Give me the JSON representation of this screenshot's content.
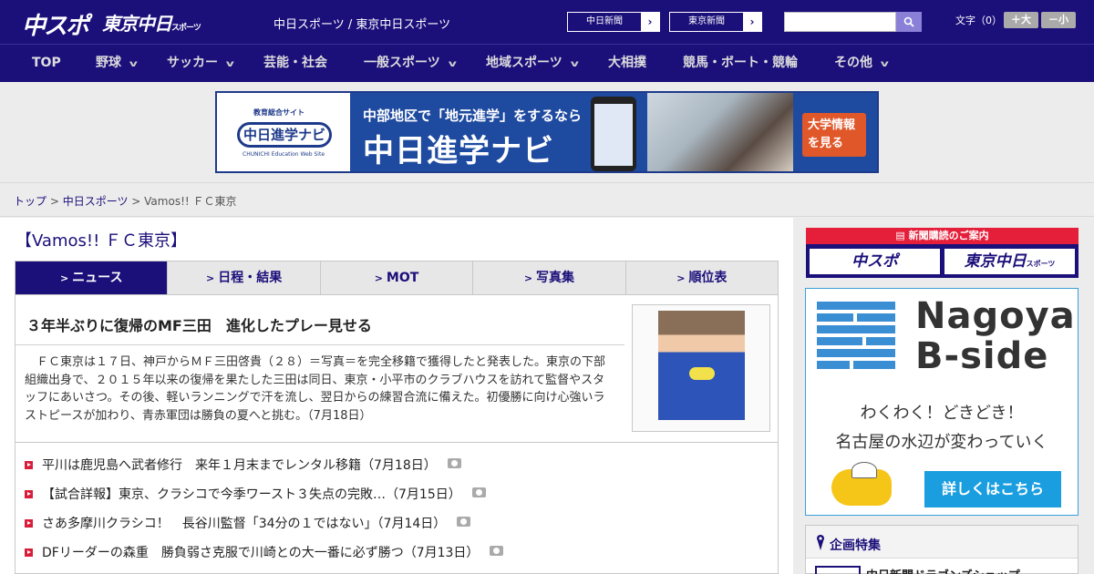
{
  "header": {
    "logo_main": "中スポ",
    "logo_tokyo": "東京中日",
    "logo_tokyo_small": "スポーツ",
    "site_name": "中日スポーツ / 東京中日スポーツ",
    "paper_buttons": [
      "中日新聞",
      "東京新聞"
    ],
    "search_placeholder": "",
    "text_size_label": "文字（0）",
    "size_up": "＋大",
    "size_down": "－小"
  },
  "nav": {
    "items": [
      {
        "label": "TOP",
        "dropdown": false
      },
      {
        "label": "野球",
        "dropdown": true
      },
      {
        "label": "サッカー",
        "dropdown": true
      },
      {
        "label": "芸能・社会",
        "dropdown": false
      },
      {
        "label": "一般スポーツ",
        "dropdown": true
      },
      {
        "label": "地域スポーツ",
        "dropdown": true
      },
      {
        "label": "大相撲",
        "dropdown": false
      },
      {
        "label": "競馬・ボート・競輪",
        "dropdown": false
      },
      {
        "label": "その他",
        "dropdown": true
      }
    ]
  },
  "banner": {
    "site_label": "教育総合サイト",
    "logo_text": "中日進学ナビ",
    "logo_sub": "CHUNICHI Education Web Site",
    "tagline": "中部地区で「地元進学」をするなら",
    "title": "中日進学ナビ",
    "cta": "大学情報を見る"
  },
  "breadcrumb": {
    "top": "トップ",
    "section": "中日スポーツ",
    "current": "Vamos!! ＦＣ東京",
    "separator": " > "
  },
  "section_title": "【Vamos!! ＦＣ東京】",
  "tabs": [
    {
      "label": "ニュース",
      "active": true
    },
    {
      "label": "日程・結果",
      "active": false
    },
    {
      "label": "MOT",
      "active": false
    },
    {
      "label": "写真集",
      "active": false
    },
    {
      "label": "順位表",
      "active": false
    }
  ],
  "article": {
    "headline": "３年半ぶりに復帰のMF三田　進化したプレー見せる",
    "body": "　ＦＣ東京は１７日、神戸からＭＦ三田啓貴（２８）＝写真＝を完全移籍で獲得したと発表した。東京の下部組織出身で、２０１５年以来の復帰を果たした三田は同日、東京・小平市のクラブハウスを訪れて監督やスタッフにあいさつ。その後、軽いランニングで汗を流し、翌日からの練習合流に備えた。初優勝に向け心強いラストピースが加わり、青赤軍団は勝負の夏へと挑む。（7月18日）"
  },
  "news": [
    {
      "title": "平川は鹿児島へ武者修行　来年１月末までレンタル移籍（7月18日）",
      "photo": true
    },
    {
      "title": "【試合詳報】東京、クラシコで今季ワースト３失点の完敗…（7月15日）",
      "photo": true
    },
    {
      "title": "さあ多摩川クラシコ！　長谷川監督「34分の１ではない」（7月14日）",
      "photo": true
    },
    {
      "title": "DFリーダーの森重　勝負弱さ克服で川崎との大一番に必ず勝つ（7月13日）",
      "photo": true
    }
  ],
  "sidebar": {
    "subscribe_head": "新聞購読のご案内",
    "subscribe_left": "中スポ",
    "subscribe_right": "東京中日",
    "subscribe_right_small": "スポーツ",
    "ad": {
      "name_line1": "Nagoya",
      "name_line2": "B-side",
      "line1": "わくわく！どきどき！",
      "line2": "名古屋の水辺が変わっていく",
      "cta": "詳しくはこちら"
    },
    "feature_title": "企画特集",
    "feature_item": "中日新聞ドラゴンズショップ"
  },
  "colors": {
    "brand": "#1b0f7a",
    "accent_red": "#e51f3a",
    "ad_blue": "#1a9ee0"
  }
}
